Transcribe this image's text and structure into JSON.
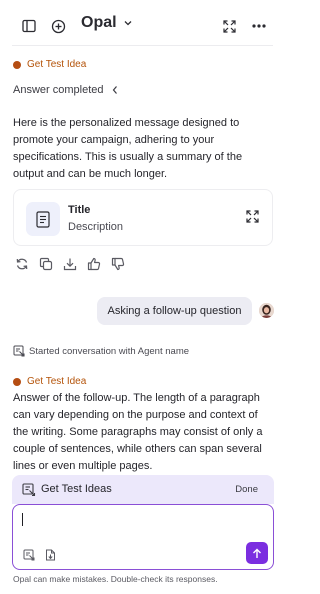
{
  "header": {
    "brand_name": "Opal"
  },
  "conversation": {
    "tag_1": "Get Test Idea",
    "answer_status": "Answer completed",
    "message_1": "Here is the personalized message designed to promote your campaign, adhering to your specifications. This is usually a summary of the output and can be much longer.",
    "document_card": {
      "title": "Title",
      "description": "Description"
    },
    "user_message": "Asking a follow-up question",
    "started_text": "Started conversation with Agent name",
    "tag_2": "Get Test Idea",
    "message_2": "Answer of the follow-up. The length of a paragraph can vary depending on the purpose and context of the writing. Some paragraphs may consist of only a couple of sentences, while others can span several lines or even multiple pages."
  },
  "composer": {
    "suggestion_label": "Get Test Ideas",
    "done_label": "Done",
    "input_value": ""
  },
  "disclaimer": "Opal can make mistakes. Double-check its responses.",
  "colors": {
    "accent": "#7b2ee0",
    "tag": "#b45309",
    "bubble": "#ececf3",
    "suggestion_bg": "#ece8fb"
  }
}
